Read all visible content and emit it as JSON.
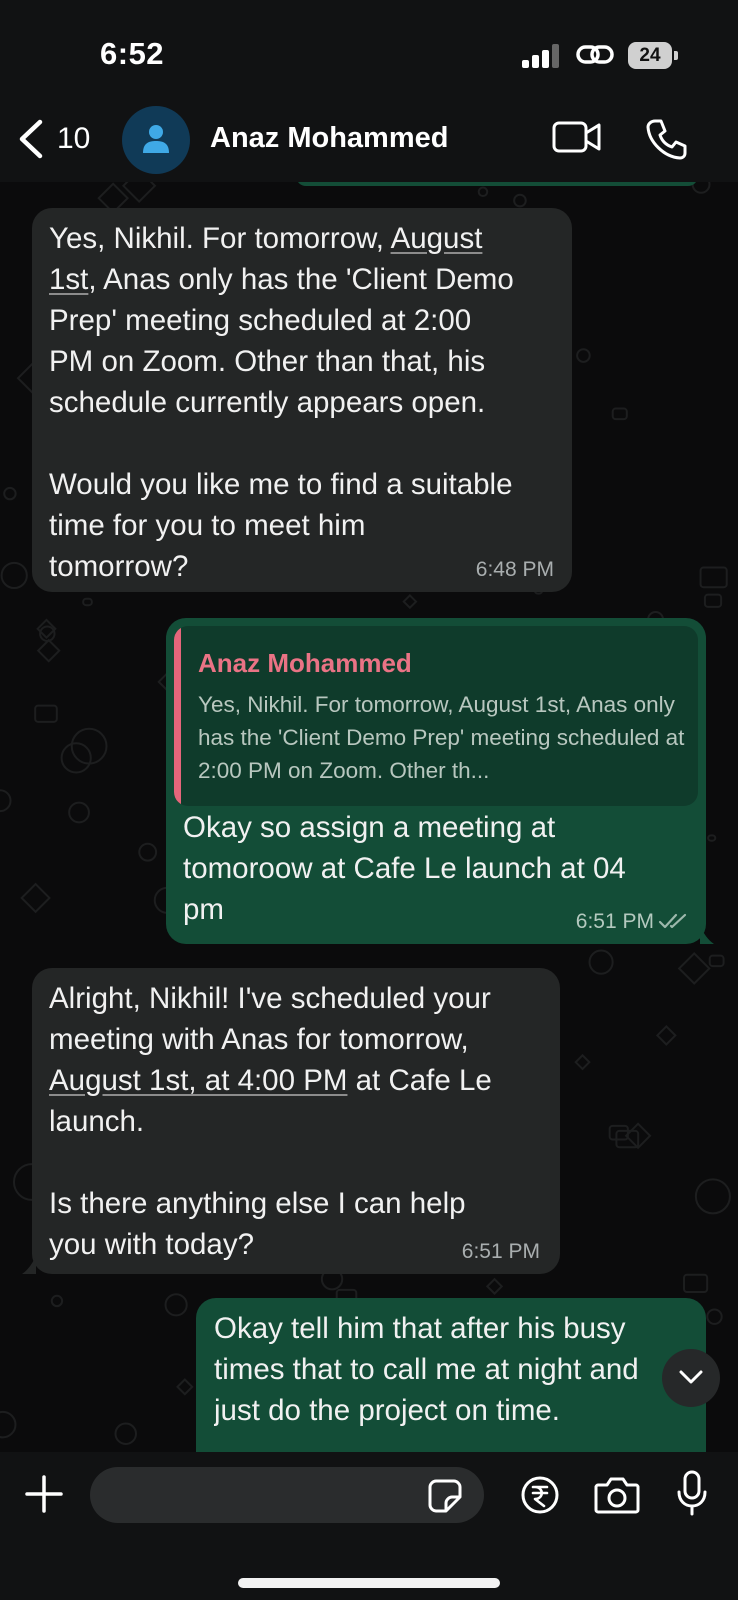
{
  "status_bar": {
    "time": "6:52",
    "battery": "24"
  },
  "header": {
    "back_count": "10",
    "contact_name": "Anaz Mohammed"
  },
  "messages": [
    {
      "direction": "incoming",
      "text_before": "Yes, Nikhil. For tomorrow, ",
      "link1": "August\n1st",
      "text_after": ", Anas only has the 'Client Demo\nPrep' meeting scheduled at 2:00\nPM on Zoom. Other than that, his\nschedule currently appears open.\n\nWould you like me to find a suitable\ntime for you to meet him\ntomorrow?",
      "time": "6:48 PM"
    },
    {
      "direction": "outgoing",
      "quote_name": "Anaz Mohammed",
      "quote_text": "Yes, Nikhil. For tomorrow, August 1st, Anas only has the 'Client Demo Prep' meeting scheduled at 2:00 PM on Zoom. Other th...",
      "text": "Okay so assign a meeting at\ntomoroow at Cafe Le launch at 04\npm",
      "time": "6:51 PM",
      "read_receipt": "double-check"
    },
    {
      "direction": "incoming",
      "text_before": "Alright, Nikhil! I've scheduled your\nmeeting with Anas for tomorrow,\n",
      "link1": "August 1st, at 4:00 PM",
      "text_after": " at Cafe Le\nlaunch.\n\nIs there anything else I can help\nyou with today?",
      "time": "6:51 PM"
    },
    {
      "direction": "outgoing",
      "text": "Okay tell him that after his busy\ntimes that to call me at night and\njust do the project on time."
    }
  ],
  "input": {
    "placeholder": ""
  },
  "colors": {
    "incoming_bubble": "#242626",
    "outgoing_bubble": "#134d37",
    "quote_accent": "#e5667b",
    "background": "#0b0b0c"
  },
  "icons": [
    "back-icon",
    "avatar-icon",
    "video-call-icon",
    "phone-call-icon",
    "double-check-icon",
    "chevron-down-icon",
    "plus-icon",
    "sticker-icon",
    "rupee-icon",
    "camera-icon",
    "mic-icon"
  ]
}
